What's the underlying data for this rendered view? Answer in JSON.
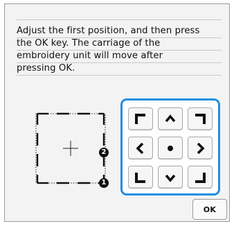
{
  "message": {
    "lines": [
      "Adjust the first position, and then press",
      "the OK key. The carriage of the",
      "embroidery unit will move after",
      "pressing OK."
    ]
  },
  "diagram": {
    "callouts": [
      "2",
      "1"
    ]
  },
  "keypad": {
    "accent_color": "#1f8fe0",
    "keys": [
      {
        "name": "move-up-left",
        "icon": "corner-up-left-icon"
      },
      {
        "name": "move-up",
        "icon": "chevron-up-icon"
      },
      {
        "name": "move-up-right",
        "icon": "corner-up-right-icon"
      },
      {
        "name": "move-left",
        "icon": "chevron-left-icon"
      },
      {
        "name": "move-center",
        "icon": "center-dot-icon"
      },
      {
        "name": "move-right",
        "icon": "chevron-right-icon"
      },
      {
        "name": "move-down-left",
        "icon": "corner-down-left-icon"
      },
      {
        "name": "move-down",
        "icon": "chevron-down-icon"
      },
      {
        "name": "move-down-right",
        "icon": "corner-down-right-icon"
      }
    ]
  },
  "ok_button": {
    "label": "OK"
  }
}
